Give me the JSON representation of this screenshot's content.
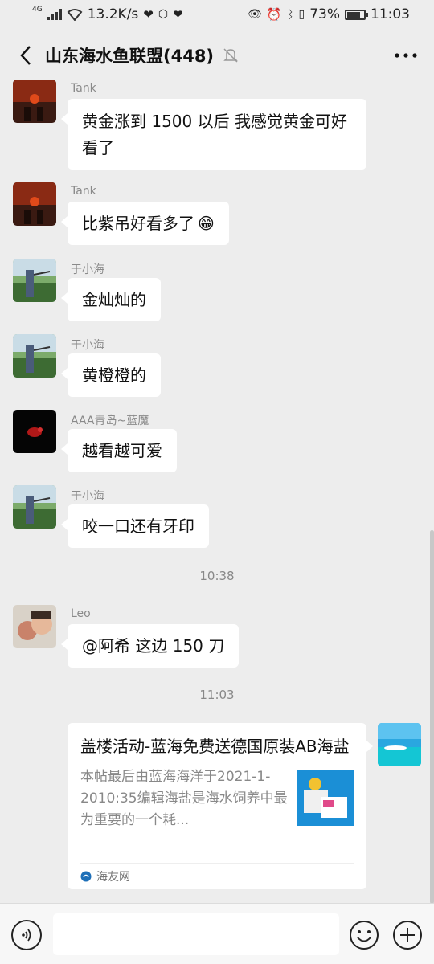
{
  "status_bar": {
    "network_type": "4G",
    "speed": "13.2K/s",
    "battery": "73%",
    "battery_level": 0.73,
    "time": "11:03"
  },
  "header": {
    "title": "山东海水鱼联盟(448)"
  },
  "messages": [
    {
      "sender": "Tank",
      "text": "黄金涨到 1500 以后 我感觉黄金可好看了",
      "avatar": "sunset-couple"
    },
    {
      "sender": "Tank",
      "text": "比紫吊好看多了",
      "emoji": "😁",
      "avatar": "sunset-couple"
    },
    {
      "sender": "于小海",
      "text": "金灿灿的",
      "avatar": "archer"
    },
    {
      "sender": "于小海",
      "text": "黄橙橙的",
      "avatar": "archer"
    },
    {
      "sender": "AAA青岛~蓝魔",
      "text": "越看越可爱",
      "avatar": "red-fish-dark"
    },
    {
      "sender": "于小海",
      "text": "咬一口还有牙印",
      "avatar": "archer"
    },
    {
      "sender": "Leo",
      "text": "@阿希  这边 150 刀",
      "avatar": "family-photo"
    }
  ],
  "timestamps": [
    "10:38",
    "11:03"
  ],
  "link_card": {
    "title": "盖楼活动-蓝海免费送德国原装AB海盐",
    "description": "本帖最后由蓝海海洋于2021-1-2010:35编辑海盐是海水饲养中最为重要的一个耗...",
    "source": "海友网"
  },
  "colors": {
    "background": "#ededed",
    "bubble": "#ffffff",
    "timestamp": "#888888"
  }
}
